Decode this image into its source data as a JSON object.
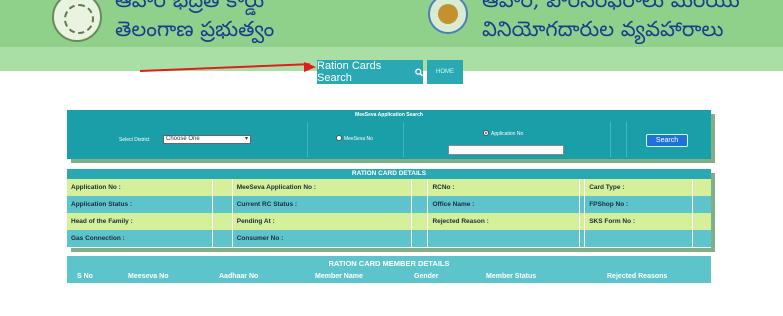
{
  "header": {
    "left_line1": "ఆహార భద్రత కార్డు",
    "left_line2": "తెలంగాణ ప్రభుత్వం",
    "right_line1": "ఆహార, పౌరసరఫరాలు మరియు",
    "right_line2": "వినియోగదారుల వ్యవహారాలు"
  },
  "nav": {
    "ration_search_label": "Ration Cards Search",
    "home_label": "HOME"
  },
  "search_panel": {
    "title": "MeeSeva Application Search",
    "district_label": "Select District",
    "district_value": "Choose One",
    "radio_meeseva_label": "MeeSeva No",
    "radio_application_label": "Application No",
    "application_input_value": "",
    "search_button_label": "Search"
  },
  "details": {
    "title": "RATION CARD DETAILS",
    "rows": [
      [
        "Application No :",
        "MeeSeva Application No :",
        "RCNo :",
        "Card Type :"
      ],
      [
        "Application Status :",
        "Current RC Status :",
        "Office Name :",
        "FPShop No :"
      ],
      [
        "Head of the Family :",
        "Pending At :",
        "Rejected Reason :",
        "SKS Form No :"
      ],
      [
        "Gas Connection :",
        "Consumer No :",
        "",
        ""
      ]
    ]
  },
  "members": {
    "title": "RATION CARD MEMBER DETAILS",
    "columns": [
      "S No",
      "Meeseva No",
      "Aadhaar No",
      "Member Name",
      "Gender",
      "Member Status",
      "Rejected Reasons"
    ]
  },
  "colors": {
    "header_green": "#8fd08a",
    "teal": "#2aa8b3",
    "light_row": "#d6ef9b",
    "teal_row": "#5ec4cc",
    "search_blue": "#1e73d8",
    "arrow_red": "#e11e1e"
  },
  "icons": {
    "search_icon": "search-icon",
    "left_emblem": "telangana-emblem",
    "right_emblem": "civil-supplies-emblem"
  }
}
